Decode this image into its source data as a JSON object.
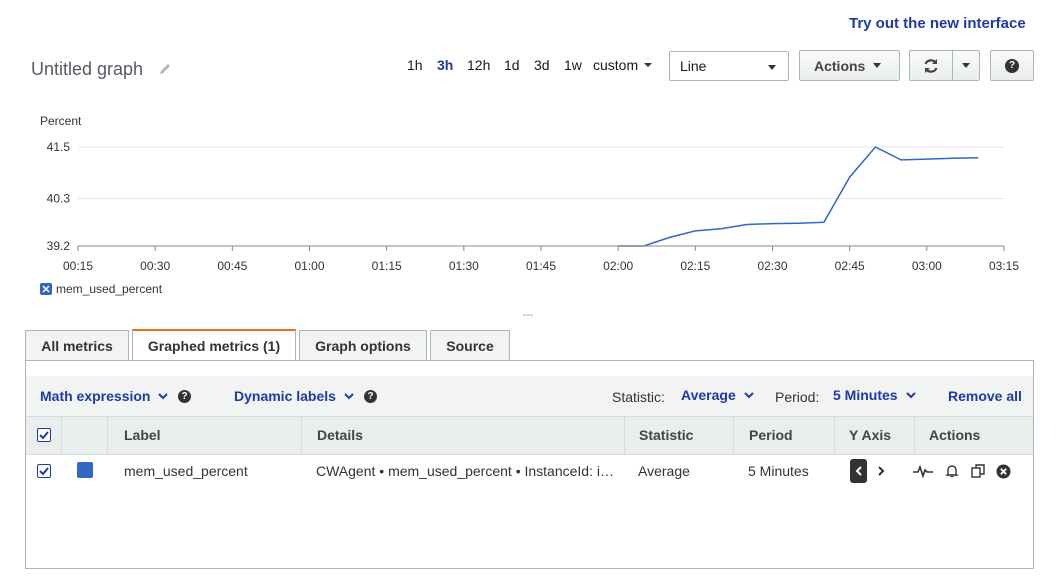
{
  "header": {
    "new_interface_link": "Try out the new interface"
  },
  "graph": {
    "title": "Untitled graph"
  },
  "time_ranges": [
    "1h",
    "3h",
    "12h",
    "1d",
    "3d",
    "1w",
    "custom"
  ],
  "active_range": "3h",
  "view_select": {
    "value": "Line"
  },
  "actions_label": "Actions",
  "help_label": "?",
  "chart_data": {
    "type": "line",
    "ylabel": "Percent",
    "yticks": [
      "41.5",
      "40.3",
      "39.2"
    ],
    "ylim": [
      39.2,
      41.5
    ],
    "xticks": [
      "00:15",
      "00:30",
      "00:45",
      "01:00",
      "01:15",
      "01:30",
      "01:45",
      "02:00",
      "02:15",
      "02:30",
      "02:45",
      "03:00",
      "03:15"
    ],
    "series": [
      {
        "name": "mem_used_percent",
        "color": "#3268c4",
        "x": [
          "02:00",
          "02:05",
          "02:10",
          "02:15",
          "02:20",
          "02:25",
          "02:30",
          "02:35",
          "02:40",
          "02:45",
          "02:50",
          "02:55",
          "03:00",
          "03:05",
          "03:10"
        ],
        "y": [
          39.2,
          39.2,
          39.4,
          39.55,
          39.6,
          39.7,
          39.72,
          39.73,
          39.75,
          40.8,
          41.5,
          41.2,
          41.22,
          41.24,
          41.25
        ]
      }
    ]
  },
  "collapse_handle": "---",
  "tabs": [
    {
      "label": "All metrics"
    },
    {
      "label": "Graphed metrics (1)"
    },
    {
      "label": "Graph options"
    },
    {
      "label": "Source"
    }
  ],
  "toolbar": {
    "math_expression": "Math expression",
    "dynamic_labels": "Dynamic labels",
    "statistic_label": "Statistic:",
    "statistic_value": "Average",
    "period_label": "Period:",
    "period_value": "5 Minutes",
    "remove_all": "Remove all"
  },
  "table": {
    "columns": [
      "Label",
      "Details",
      "Statistic",
      "Period",
      "Y Axis",
      "Actions"
    ],
    "rows": [
      {
        "color": "#3268c4",
        "label": "mem_used_percent",
        "details": "CWAgent • mem_used_percent • InstanceId: i…",
        "statistic": "Average",
        "period": "5 Minutes"
      }
    ]
  }
}
